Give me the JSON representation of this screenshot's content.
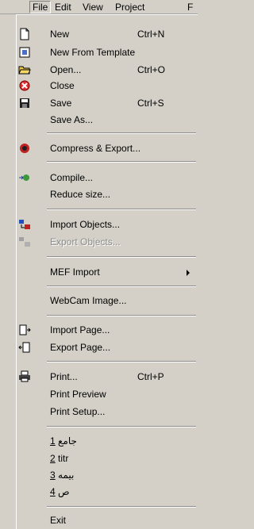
{
  "menubar": {
    "file": "File",
    "edit": "Edit",
    "view": "View",
    "project": "Project",
    "more": "F"
  },
  "file_menu": {
    "new": {
      "label": "New",
      "shortcut": "Ctrl+N",
      "icon": "new-document-icon"
    },
    "new_from_template": {
      "label": "New From Template",
      "icon": "template-icon"
    },
    "open": {
      "label": "Open...",
      "shortcut": "Ctrl+O",
      "icon": "open-folder-icon"
    },
    "close": {
      "label": "Close",
      "icon": "close-icon"
    },
    "save": {
      "label": "Save",
      "shortcut": "Ctrl+S",
      "icon": "save-disk-icon"
    },
    "save_as": {
      "label": "Save As..."
    },
    "compress_export": {
      "label": "Compress & Export...",
      "icon": "compress-export-icon"
    },
    "compile": {
      "label": "Compile...",
      "icon": "compile-icon"
    },
    "reduce_size": {
      "label": "Reduce size..."
    },
    "import_objects": {
      "label": "Import Objects...",
      "icon": "import-objects-icon"
    },
    "export_objects": {
      "label": "Export Objects...",
      "icon": "export-objects-icon",
      "disabled": true
    },
    "mef_import": {
      "label": "MEF Import"
    },
    "webcam_image": {
      "label": "WebCam Image..."
    },
    "import_page": {
      "label": "Import Page...",
      "icon": "import-page-icon"
    },
    "export_page": {
      "label": "Export Page...",
      "icon": "export-page-icon"
    },
    "print": {
      "label": "Print...",
      "shortcut": "Ctrl+P",
      "icon": "printer-icon"
    },
    "print_preview": {
      "label": "Print Preview"
    },
    "print_setup": {
      "label": "Print Setup..."
    },
    "recent": [
      {
        "num": "1",
        "name": "جامع"
      },
      {
        "num": "2",
        "name": "titr"
      },
      {
        "num": "3",
        "name": "بيمه"
      },
      {
        "num": "4",
        "name": "ص"
      }
    ],
    "exit": {
      "label": "Exit"
    }
  }
}
